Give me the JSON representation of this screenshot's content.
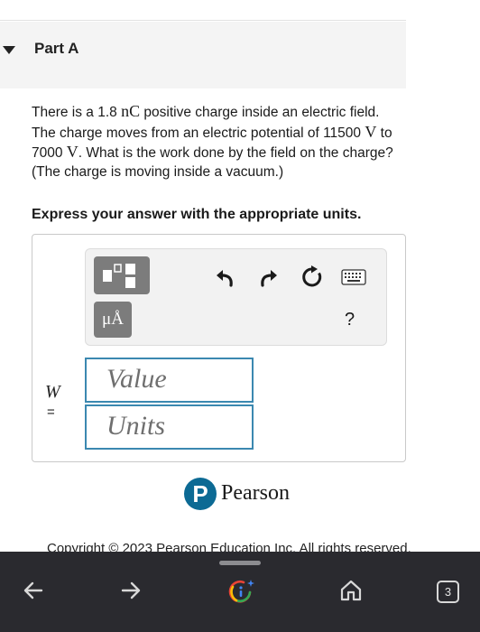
{
  "part": {
    "title": "Part A"
  },
  "question": {
    "t1": "There is a 1.8 ",
    "u1": "nC",
    "t2": " positive charge inside an electric field. The charge moves from an electric potential of 11500 ",
    "u2": "V",
    "t3": " to 7000 ",
    "u3": "V",
    "t4": ". What is the work done by the field on the charge? (The charge is moving inside a vacuum.)"
  },
  "instruction": "Express your answer with the appropriate units.",
  "toolbar": {
    "units_label": "μÅ",
    "help_label": "?"
  },
  "answer": {
    "variable": "W",
    "equals": "=",
    "value_placeholder": "Value",
    "units_placeholder": "Units"
  },
  "footer": {
    "brand_letter": "P",
    "brand_name": "Pearson",
    "copyright": "Copyright © 2023 Pearson Education Inc. All rights reserved."
  },
  "navbar": {
    "tab_count": "3"
  },
  "icons": {
    "toggle": "caret-down-icon",
    "templates": "templates-icon",
    "undo": "undo-icon",
    "redo": "redo-icon",
    "reset": "reset-icon",
    "keyboard": "keyboard-icon",
    "back": "back-arrow-icon",
    "forward": "forward-arrow-icon",
    "google": "google-lens-icon",
    "home": "home-icon"
  },
  "colors": {
    "field_border": "#3b88b0",
    "pearson_blue": "#0c6a94",
    "navbar_bg": "#2a2a2f",
    "toolbar_button": "#7c7c7c"
  }
}
